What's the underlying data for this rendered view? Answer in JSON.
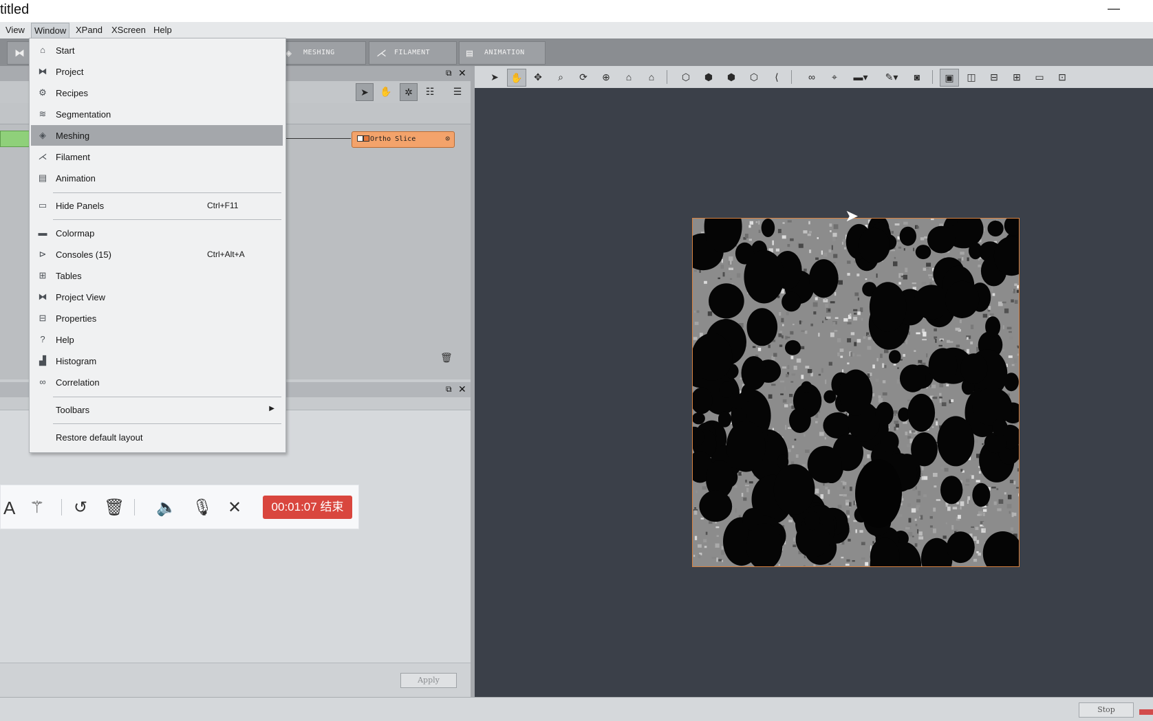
{
  "window": {
    "title": "titled",
    "minimize_glyph": "—"
  },
  "menubar": {
    "items": [
      "View",
      "Window",
      "XPand",
      "XScreen",
      "Help"
    ],
    "active": "Window"
  },
  "workroom_tabs": [
    {
      "label": "MESHING",
      "icon": "meshing-icon"
    },
    {
      "label": "FILAMENT",
      "icon": "filament-icon"
    },
    {
      "label": "ANIMATION",
      "icon": "animation-icon"
    }
  ],
  "project_view": {
    "node_label": "Ortho Slice"
  },
  "window_menu": {
    "items": [
      {
        "label": "Start",
        "icon": "home-icon",
        "shortcut": ""
      },
      {
        "label": "Project",
        "icon": "project-icon",
        "shortcut": ""
      },
      {
        "label": "Recipes",
        "icon": "recipes-icon",
        "shortcut": ""
      },
      {
        "label": "Segmentation",
        "icon": "segmentation-icon",
        "shortcut": ""
      },
      {
        "label": "Meshing",
        "icon": "meshing-icon",
        "shortcut": "",
        "highlighted": true
      },
      {
        "label": "Filament",
        "icon": "filament-icon",
        "shortcut": ""
      },
      {
        "label": "Animation",
        "icon": "animation-icon",
        "shortcut": ""
      },
      {
        "label": "Hide Panels",
        "icon": "hide-panels-icon",
        "shortcut": "Ctrl+F11"
      },
      {
        "label": "Colormap",
        "icon": "colormap-icon",
        "shortcut": ""
      },
      {
        "label": "Consoles (15)",
        "icon": "console-icon",
        "shortcut": "Ctrl+Alt+A"
      },
      {
        "label": "Tables",
        "icon": "tables-icon",
        "shortcut": ""
      },
      {
        "label": "Project View",
        "icon": "project-view-icon",
        "shortcut": ""
      },
      {
        "label": "Properties",
        "icon": "properties-icon",
        "shortcut": ""
      },
      {
        "label": "Help",
        "icon": "help-icon",
        "shortcut": ""
      },
      {
        "label": "Histogram",
        "icon": "histogram-icon",
        "shortcut": ""
      },
      {
        "label": "Correlation",
        "icon": "correlation-icon",
        "shortcut": ""
      },
      {
        "label": "Toolbars",
        "icon": "",
        "shortcut": "",
        "submenu": true
      },
      {
        "label": "Restore default layout",
        "icon": "",
        "shortcut": ""
      }
    ]
  },
  "properties": {
    "apply_label": "Apply"
  },
  "recorder": {
    "timer": "00:01:07 结束",
    "text_tool": "A"
  },
  "statusbar": {
    "stop_label": "Stop"
  },
  "colors": {
    "accent_orange": "#f3a36b",
    "frame_orange": "#d9823f",
    "viewer_bg": "#3b4049",
    "timer_red": "#d9463e"
  }
}
